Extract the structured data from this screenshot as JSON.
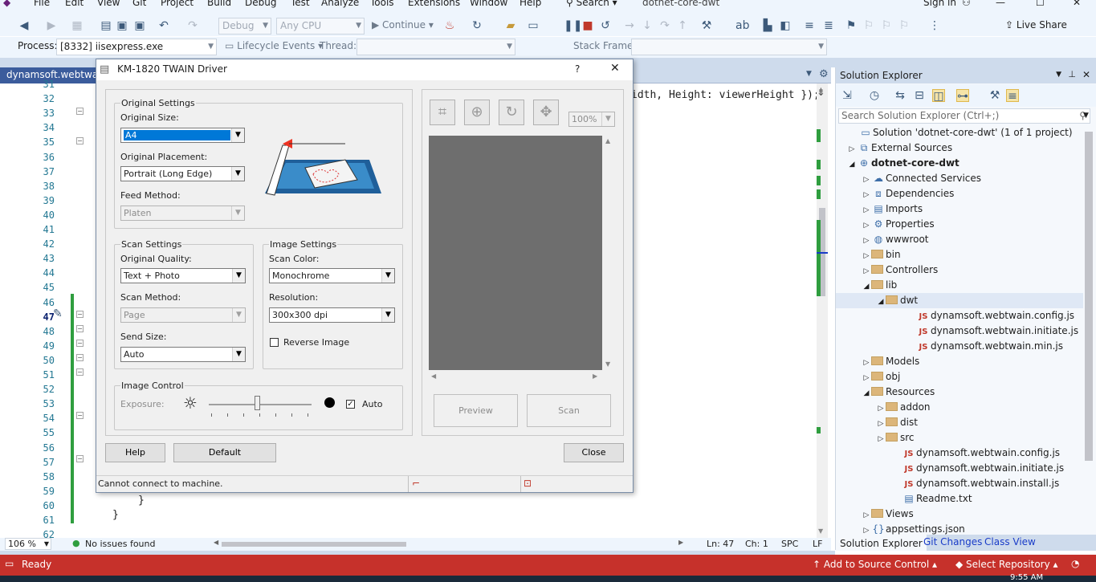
{
  "menu": [
    "File",
    "Edit",
    "View",
    "Git",
    "Project",
    "Build",
    "Debug",
    "Test",
    "Analyze",
    "Tools",
    "Extensions",
    "Window",
    "Help"
  ],
  "search_label": "Search",
  "solution_name": "dotnet-core-dwt",
  "sign_in": "Sign in",
  "toolbar": {
    "config": "Debug",
    "platform": "Any CPU",
    "continue": "Continue",
    "live_share": "Live Share"
  },
  "toolbar2": {
    "process_label": "Process:",
    "process_value": "[8332] iisexpress.exe",
    "lifecycle": "Lifecycle Events",
    "thread_label": "Thread:",
    "stack_label": "Stack Frame:"
  },
  "doc_tab": "dynamsoft.webtwain",
  "code": {
    "line_numbers": [
      "31",
      "32",
      "33",
      "34",
      "35",
      "36",
      "37",
      "38",
      "39",
      "40",
      "41",
      "42",
      "43",
      "44",
      "45",
      "46",
      "47",
      "48",
      "49",
      "50",
      "51",
      "52",
      "53",
      "54",
      "55",
      "56",
      "57",
      "58",
      "59",
      "60",
      "61",
      "62"
    ],
    "current_line": "47",
    "visible_code_top": "idth, Height: viewerHeight });",
    "brace1": "}",
    "brace2": "}"
  },
  "editor_status": {
    "zoom": "106 %",
    "issues": "No issues found",
    "ln": "Ln: 47",
    "ch": "Ch: 1",
    "spc": "SPC",
    "lf": "LF"
  },
  "statusbar": {
    "ready": "Ready",
    "source_control": "Add to Source Control",
    "repository": "Select Repository",
    "time": "9:55 AM"
  },
  "solution_explorer": {
    "title": "Solution Explorer",
    "search_placeholder": "Search Solution Explorer (Ctrl+;)",
    "items": [
      {
        "label": "Solution 'dotnet-core-dwt' (1 of 1 project)",
        "icon": "solution-icon"
      },
      {
        "label": "External Sources",
        "icon": "external-sources-icon"
      },
      {
        "label": "dotnet-core-dwt",
        "icon": "web-project-icon"
      },
      {
        "label": "Connected Services",
        "icon": "connected-services-icon"
      },
      {
        "label": "Dependencies",
        "icon": "dependencies-icon"
      },
      {
        "label": "Imports",
        "icon": "imports-icon"
      },
      {
        "label": "Properties",
        "icon": "properties-icon"
      },
      {
        "label": "wwwroot",
        "icon": "globe-icon"
      },
      {
        "label": "bin",
        "icon": "folder-icon"
      },
      {
        "label": "Controllers",
        "icon": "folder-icon"
      },
      {
        "label": "lib",
        "icon": "folder-icon"
      },
      {
        "label": "dwt",
        "icon": "folder-icon"
      },
      {
        "label": "dynamsoft.webtwain.config.js",
        "icon": "js-file-icon"
      },
      {
        "label": "dynamsoft.webtwain.initiate.js",
        "icon": "js-file-icon"
      },
      {
        "label": "dynamsoft.webtwain.min.js",
        "icon": "js-file-icon"
      },
      {
        "label": "Models",
        "icon": "folder-icon"
      },
      {
        "label": "obj",
        "icon": "folder-icon"
      },
      {
        "label": "Resources",
        "icon": "folder-icon"
      },
      {
        "label": "addon",
        "icon": "folder-icon"
      },
      {
        "label": "dist",
        "icon": "folder-icon"
      },
      {
        "label": "src",
        "icon": "folder-icon"
      },
      {
        "label": "dynamsoft.webtwain.config.js",
        "icon": "js-file-icon"
      },
      {
        "label": "dynamsoft.webtwain.initiate.js",
        "icon": "js-file-icon"
      },
      {
        "label": "dynamsoft.webtwain.install.js",
        "icon": "js-file-icon"
      },
      {
        "label": "Readme.txt",
        "icon": "text-file-icon"
      },
      {
        "label": "Views",
        "icon": "folder-icon"
      },
      {
        "label": "appsettings.json",
        "icon": "json-file-icon"
      }
    ],
    "tabs": [
      "Solution Explorer",
      "Git Changes",
      "Class View"
    ]
  },
  "dialog": {
    "title": "KM-1820 TWAIN Driver",
    "help_q": "?",
    "original_settings": "Original Settings",
    "original_size_label": "Original Size:",
    "original_size": "A4",
    "original_placement_label": "Original Placement:",
    "original_placement": "Portrait (Long Edge)",
    "feed_method_label": "Feed Method:",
    "feed_method": "Platen",
    "scan_settings": "Scan Settings",
    "original_quality_label": "Original Quality:",
    "original_quality": "Text + Photo",
    "scan_method_label": "Scan Method:",
    "scan_method": "Page",
    "send_size_label": "Send Size:",
    "send_size": "Auto",
    "image_settings": "Image Settings",
    "scan_color_label": "Scan Color:",
    "scan_color": "Monochrome",
    "resolution_label": "Resolution:",
    "resolution": "300x300 dpi",
    "reverse_image": "Reverse Image",
    "image_control": "Image Control",
    "exposure_label": "Exposure:",
    "exposure_level": 0.48,
    "auto": "Auto",
    "zoom": "100%",
    "preview": "Preview",
    "scan": "Scan",
    "help": "Help",
    "default": "Default",
    "close": "Close",
    "status": "Cannot connect to machine."
  }
}
